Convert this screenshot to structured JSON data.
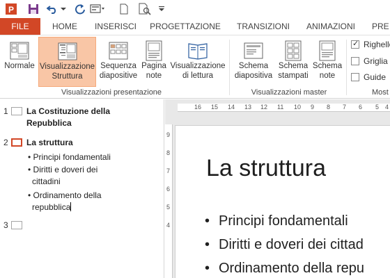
{
  "qat": {
    "icons": [
      "powerpoint-logo-icon",
      "save-icon",
      "undo-icon",
      "undo-dropdown-icon",
      "repeat-icon",
      "presentation-mode-icon",
      "new-icon",
      "print-preview-icon",
      "customize-dropdown-icon"
    ]
  },
  "tabs": [
    "FILE",
    "HOME",
    "INSERISCI",
    "PROGETTAZIONE",
    "TRANSIZIONI",
    "ANIMAZIONI",
    "PRE"
  ],
  "ribbon": {
    "views": [
      {
        "label1": "Normale",
        "label2": ""
      },
      {
        "label1": "Visualizzazione",
        "label2": "Struttura"
      },
      {
        "label1": "Sequenza",
        "label2": "diapositive"
      },
      {
        "label1": "Pagina",
        "label2": "note"
      },
      {
        "label1": "Visualizzazione",
        "label2": "di lettura"
      }
    ],
    "views_group": "Visualizzazioni presentazione",
    "masters": [
      {
        "label1": "Schema",
        "label2": "diapositiva"
      },
      {
        "label1": "Schema",
        "label2": "stampati"
      },
      {
        "label1": "Schema",
        "label2": "note"
      }
    ],
    "masters_group": "Visualizzazioni master",
    "show": {
      "ruler": "Righello",
      "grid": "Griglia",
      "guides": "Guide",
      "group": "Most"
    }
  },
  "outline": {
    "slides": [
      {
        "num": "1",
        "title_line1": "La Costituzione della",
        "title_line2": "Repubblica"
      },
      {
        "num": "2",
        "title": "La struttura",
        "bullets": [
          "• Principi fondamentali",
          "• Diritti e doveri dei",
          "cittadini",
          "• Ordinamento della",
          "repubblica"
        ]
      },
      {
        "num": "3"
      }
    ]
  },
  "ruler": {
    "h": [
      "16",
      "15",
      "14",
      "13",
      "12",
      "11",
      "10",
      "9",
      "8",
      "7",
      "6",
      "5",
      "4"
    ],
    "v": [
      "9",
      "8",
      "7",
      "6",
      "5",
      "4"
    ]
  },
  "slide": {
    "title": "La struttura",
    "bullets": [
      "Principi fondamentali",
      "Diritti e doveri dei cittad",
      "Ordinamento della repu"
    ]
  },
  "colors": {
    "accent": "#d24726",
    "selected_view": "#f9c6a6"
  }
}
